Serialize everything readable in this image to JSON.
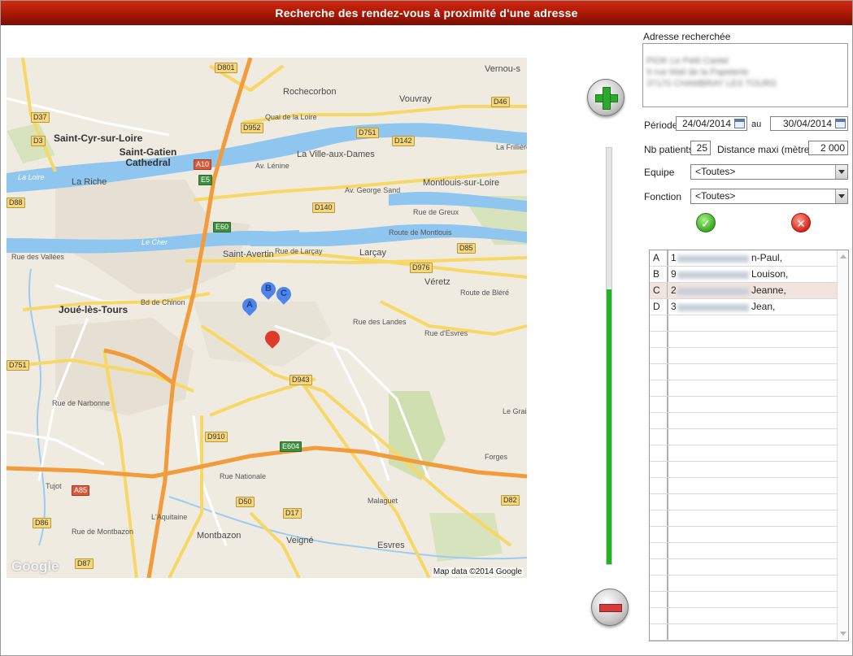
{
  "window": {
    "title": "Recherche des rendez-vous à proximité d'une adresse"
  },
  "map": {
    "attribution": "Map data ©2014 Google",
    "logo": "Google",
    "towns": [
      "Saint-Cyr-sur-Loire",
      "Saint-Gatien Cathedral",
      "Rochecorbon",
      "Vouvray",
      "Vernou-s",
      "La Ville-aux-Dames",
      "Montlouis-sur-Loire",
      "La Riche",
      "Saint-Avertin",
      "Larçay",
      "Joué-lès-Tours",
      "Véretz",
      "Montbazon",
      "Veigné",
      "Esvres",
      "Forges",
      "Tujot",
      "La Frillière"
    ],
    "rivers": [
      "La Loire",
      "Le Cher"
    ],
    "streets": [
      "Quai de la Loire",
      "Av. Lénine",
      "Av. George Sand",
      "Rue de Greux",
      "Rue de Larçay",
      "Bd de Chinon",
      "Rue des Landes",
      "Rue d'Esvres",
      "Route de Bléré",
      "Rue des Vallées",
      "Rue de Narbonne",
      "Rue Nationale",
      "Rue de Montbazon",
      "Malaguet",
      "Le Grais",
      "L'Aquitaine",
      "Route de Montlouis"
    ],
    "roads": [
      "D801",
      "D37",
      "D952",
      "D751",
      "D142",
      "D46",
      "D3",
      "A10",
      "E5",
      "D88",
      "D140",
      "E60",
      "D85",
      "D976",
      "A85",
      "E604",
      "D943",
      "D910",
      "D50",
      "D17",
      "D86",
      "D87",
      "D82",
      "D751"
    ],
    "markers": [
      {
        "letter": "A",
        "color": "#4f84e8"
      },
      {
        "letter": "B",
        "color": "#4f84e8"
      },
      {
        "letter": "C",
        "color": "#4f84e8"
      },
      {
        "letter": "",
        "color": "#e03a2a"
      }
    ],
    "zoom_level": 0.66
  },
  "zoom": {
    "in_icon": "plus-icon",
    "out_icon": "minus-icon"
  },
  "panel": {
    "address_label": "Adresse recherchée",
    "address_lines": [
      "PIOK Le Petit Castel",
      "9 rue Mail de la Papeterie",
      "37170 CHAMBRAY LES TOURS"
    ],
    "period_label": "Période:",
    "date_from": "24/04/2014",
    "to_label": "au",
    "date_to": "30/04/2014",
    "patients_label": "Nb patients",
    "patients_value": "25",
    "distance_label": "Distance maxi (mètres)",
    "distance_value": "2 000",
    "team_label": "Equipe",
    "team_value": "<Toutes>",
    "function_label": "Fonction",
    "function_value": "<Toutes>",
    "ok_icon": "check-icon",
    "cancel_icon": "close-icon"
  },
  "results": [
    {
      "letter": "A",
      "num": "1",
      "name": "n-Paul,"
    },
    {
      "letter": "B",
      "num": "9",
      "name": "Louison,"
    },
    {
      "letter": "C",
      "num": "2",
      "name": "Jeanne,",
      "selected": true
    },
    {
      "letter": "D",
      "num": "3",
      "name": "Jean,"
    }
  ],
  "colors": {
    "title_bar": "#b01a06",
    "zoom_fill": "#22b222",
    "selected_row": "#f1e4de"
  }
}
